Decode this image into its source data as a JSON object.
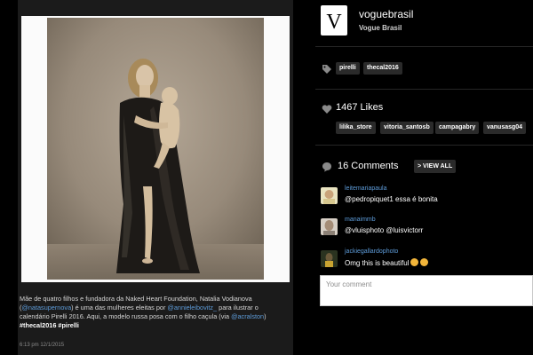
{
  "profile": {
    "username": "voguebrasil",
    "full_name": "Vogue Brasil",
    "logo_letter": "V"
  },
  "tags": [
    "pirelli",
    "thecal2016"
  ],
  "likes": {
    "label": "1467 Likes",
    "likers": [
      "lilika_store",
      "vitoria_santosb",
      "campagabry",
      "vanusasg04"
    ]
  },
  "comments_section": {
    "label": "16 Comments",
    "view_all": "> VIEW ALL",
    "items": [
      {
        "user": "leitemariapaula",
        "text": "@pedropiquet1 essa é bonita"
      },
      {
        "user": "manaimmb",
        "text": "@vluisphoto @luisvictorr"
      },
      {
        "user": "jackiegallardophoto",
        "text": "Omg this is beautiful"
      }
    ],
    "input_placeholder": "Your comment"
  },
  "post": {
    "caption": {
      "p1": "Mãe de quatro filhos e fundadora da Naked Heart Foundation, Natalia Vodianova (",
      "m1": "@natasupernova",
      "p2": ") é uma das mulheres eleitas por ",
      "m2": "@annieleibovitz_",
      "p3": " para ilustrar o calendário Pirelli 2016. Aqui, a modelo russa posa com o filho caçula (via ",
      "m3": "@acralston",
      "p4": ") ",
      "h1": "#thecal2016",
      "p5": " ",
      "h2": "#pirelli"
    },
    "time": "6:13 pm 12/1/2015"
  },
  "colors": {
    "background": "#000000",
    "panel": "#1b1b1b",
    "link": "#5d9bd8",
    "pill": "#2a2a2a"
  },
  "icons": {
    "tag": "tag-icon",
    "like": "heart-icon",
    "comment": "speech-bubble-icon"
  }
}
